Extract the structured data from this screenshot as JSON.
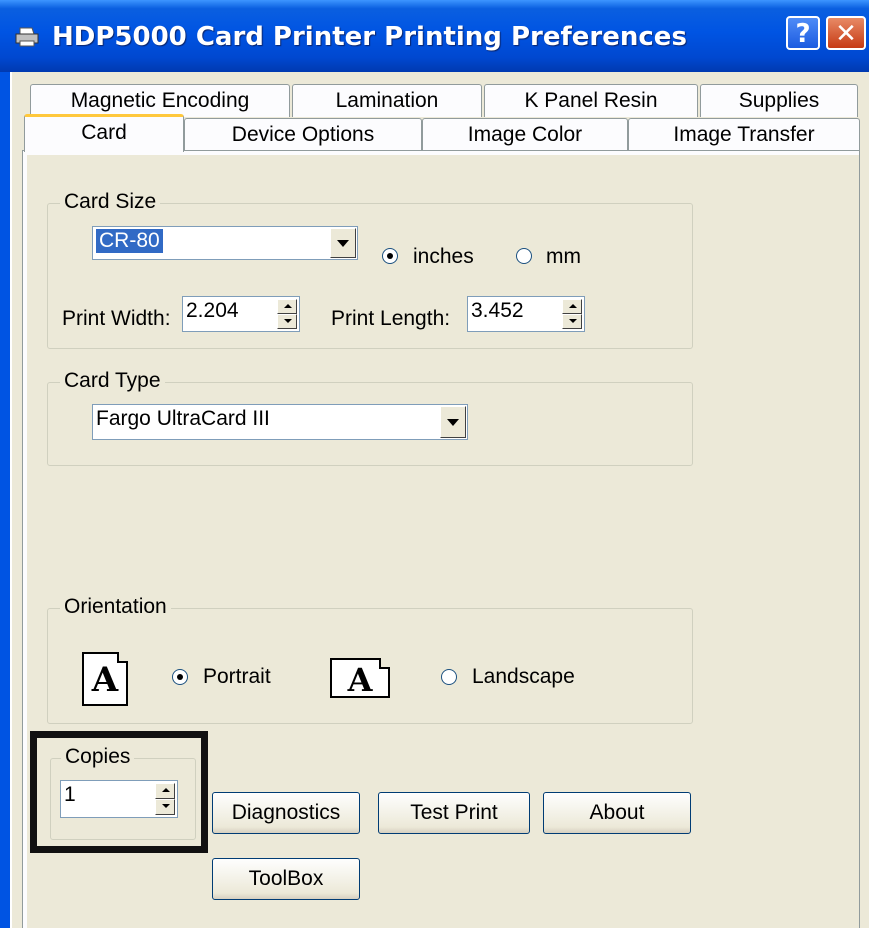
{
  "window": {
    "title": "HDP5000 Card Printer Printing Preferences",
    "help_label": "?",
    "close_label": "✕"
  },
  "tabs": {
    "row_back": [
      "Magnetic Encoding",
      "Lamination",
      "K Panel Resin",
      "Supplies"
    ],
    "row_front": [
      "Card",
      "Device Options",
      "Image Color",
      "Image Transfer"
    ],
    "active": "Card"
  },
  "card_size": {
    "group_label": "Card Size",
    "selected": "CR-80",
    "unit_inches": "inches",
    "unit_mm": "mm",
    "unit_selected": "inches",
    "print_width_label": "Print Width:",
    "print_width_value": "2.204",
    "print_length_label": "Print Length:",
    "print_length_value": "3.452"
  },
  "card_type": {
    "group_label": "Card Type",
    "selected": "Fargo UltraCard III"
  },
  "orientation": {
    "group_label": "Orientation",
    "portrait_label": "Portrait",
    "landscape_label": "Landscape",
    "selected": "Portrait",
    "icon_glyph": "A"
  },
  "copies": {
    "group_label": "Copies",
    "value": "1"
  },
  "buttons": {
    "diagnostics": "Diagnostics",
    "test_print": "Test Print",
    "about": "About",
    "toolbox": "ToolBox"
  },
  "colors": {
    "titlebar": "#0054e3",
    "face": "#ece9d8",
    "active_tab_accent": "#ffc83c",
    "selection": "#316ac5"
  }
}
